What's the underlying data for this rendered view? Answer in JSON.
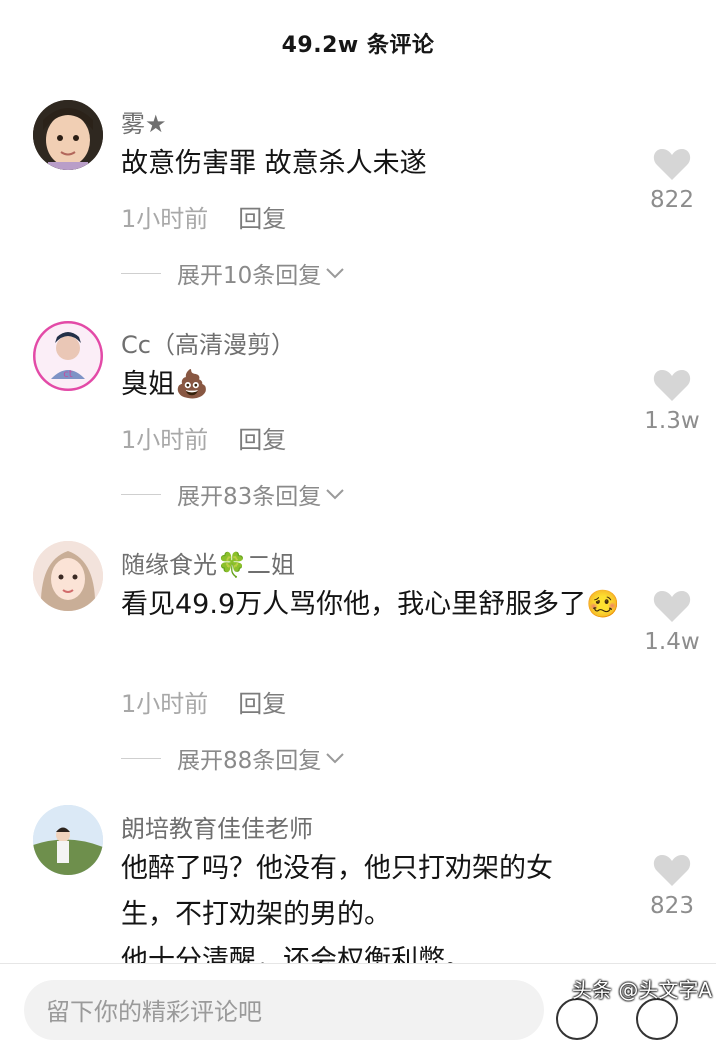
{
  "header": {
    "title": "49.2w 条评论"
  },
  "comments": [
    {
      "username": "雾★",
      "text": "故意伤害罪  故意杀人未遂",
      "time": "1小时前",
      "reply": "回复",
      "likes": "822",
      "expand": "展开10条回复"
    },
    {
      "username": "Cc（高清漫剪）",
      "text": "臭姐💩",
      "time": "1小时前",
      "reply": "回复",
      "likes": "1.3w",
      "expand": "展开83条回复"
    },
    {
      "username": "随缘食光🍀二姐",
      "text": "看见49.9万人骂你他，我心里舒服多了🥴",
      "time": "1小时前",
      "reply": "回复",
      "likes": "1.4w",
      "expand": "展开88条回复"
    },
    {
      "username": "朗培教育佳佳老师",
      "text_lines": [
        "他醉了吗？他没有，他只打劝架的女",
        "生，不打劝架的男的。",
        "他十分清醒，还会权衡利弊。"
      ],
      "likes": "823"
    }
  ],
  "input": {
    "placeholder": "留下你的精彩评论吧"
  },
  "watermark": "头条 @头文字A",
  "icons": {
    "like": "heart-icon",
    "expand": "chevron-down-icon"
  },
  "colors": {
    "heart": "#d6d6d6",
    "meta": "#a8a8a8",
    "text": "#141414"
  }
}
